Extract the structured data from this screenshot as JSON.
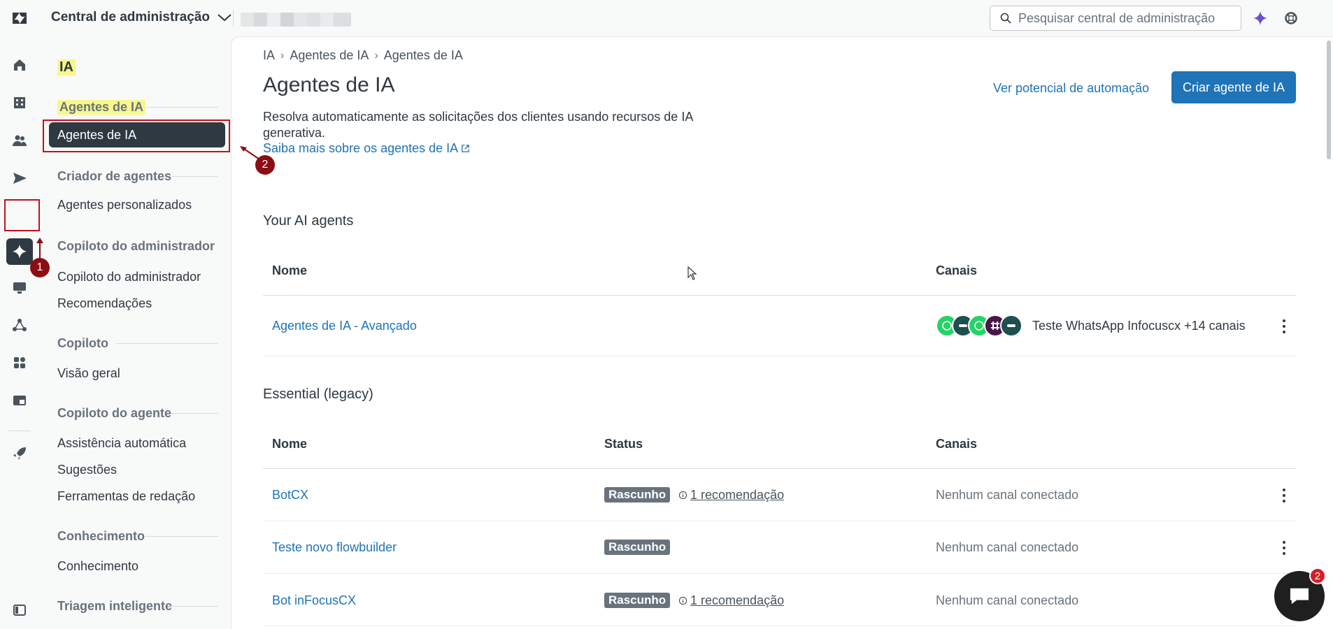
{
  "topbar": {
    "app_title": "Central de administração",
    "search_placeholder": "Pesquisar central de administração"
  },
  "subnav": {
    "heading": "IA",
    "sections": [
      {
        "title": "Agentes de IA",
        "items": [
          "Agentes de IA"
        ]
      },
      {
        "title": "Criador de agentes",
        "items": [
          "Agentes personalizados"
        ]
      },
      {
        "title": "Copiloto do administrador",
        "items": [
          "Copiloto do administrador",
          "Recomendações"
        ]
      },
      {
        "title": "Copiloto",
        "items": [
          "Visão geral"
        ]
      },
      {
        "title": "Copiloto do agente",
        "items": [
          "Assistência automática",
          "Sugestões",
          "Ferramentas de redação"
        ]
      },
      {
        "title": "Conhecimento",
        "items": [
          "Conhecimento"
        ]
      },
      {
        "title": "Triagem inteligente",
        "items": []
      }
    ]
  },
  "main": {
    "breadcrumb": [
      "IA",
      "Agentes de IA",
      "Agentes de IA"
    ],
    "title": "Agentes de IA",
    "description": "Resolva automaticamente as solicitações dos clientes usando recursos de IA generativa.",
    "learn_more": "Saiba mais sobre os agentes de IA",
    "automation_link": "Ver potencial de automação",
    "create_button": "Criar agente de IA",
    "your_agents": {
      "heading": "Your AI agents",
      "columns": [
        "Nome",
        "Canais"
      ],
      "rows": [
        {
          "name": "Agentes de IA - Avançado",
          "channels": "Teste WhatsApp Infocuscx +14 canais"
        }
      ]
    },
    "legacy": {
      "heading": "Essential (legacy)",
      "columns": [
        "Nome",
        "Status",
        "Canais"
      ],
      "rows": [
        {
          "name": "BotCX",
          "status": "Rascunho",
          "recommendation": "1 recomendação",
          "channels": "Nenhum canal conectado"
        },
        {
          "name": "Teste novo flowbuilder",
          "status": "Rascunho",
          "recommendation": "",
          "channels": "Nenhum canal conectado"
        },
        {
          "name": "Bot inFocusCX",
          "status": "Rascunho",
          "recommendation": "1 recomendação",
          "channels": "Nenhum canal conectado"
        }
      ]
    }
  },
  "annotations": {
    "one": "1",
    "two": "2"
  },
  "chat": {
    "badge": "2"
  },
  "colors": {
    "accent": "#1f73b7",
    "dark": "#2f3941",
    "annotation": "#c0121b",
    "highlight": "#f8f78c"
  }
}
